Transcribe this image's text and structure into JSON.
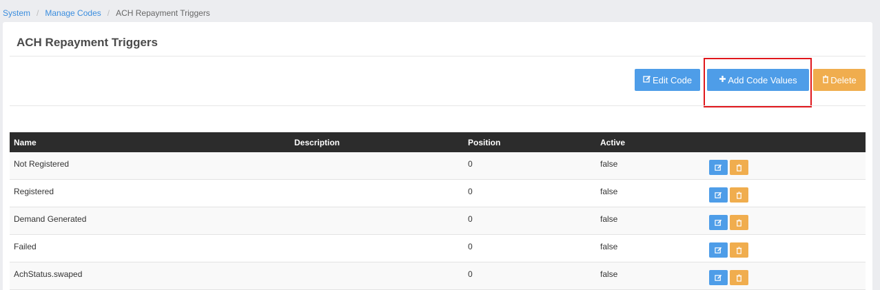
{
  "breadcrumb": {
    "items": [
      "System",
      "Manage Codes"
    ],
    "current": "ACH Repayment Triggers"
  },
  "panel": {
    "title": "ACH Repayment Triggers"
  },
  "actions": {
    "edit_label": "Edit Code",
    "add_label": "Add Code Values",
    "delete_label": "Delete"
  },
  "table": {
    "headers": [
      "Name",
      "Description",
      "Position",
      "Active"
    ],
    "rows": [
      {
        "name": "Not Registered",
        "description": "",
        "position": "0",
        "active": "false"
      },
      {
        "name": "Registered",
        "description": "",
        "position": "0",
        "active": "false"
      },
      {
        "name": "Demand Generated",
        "description": "",
        "position": "0",
        "active": "false"
      },
      {
        "name": "Failed",
        "description": "",
        "position": "0",
        "active": "false"
      },
      {
        "name": "AchStatus.swaped",
        "description": "",
        "position": "0",
        "active": "false"
      }
    ]
  },
  "colors": {
    "primary": "#4e9de8",
    "warning": "#f0ad4e",
    "header_bg": "#2c2c2c",
    "highlight": "#e0161b"
  }
}
